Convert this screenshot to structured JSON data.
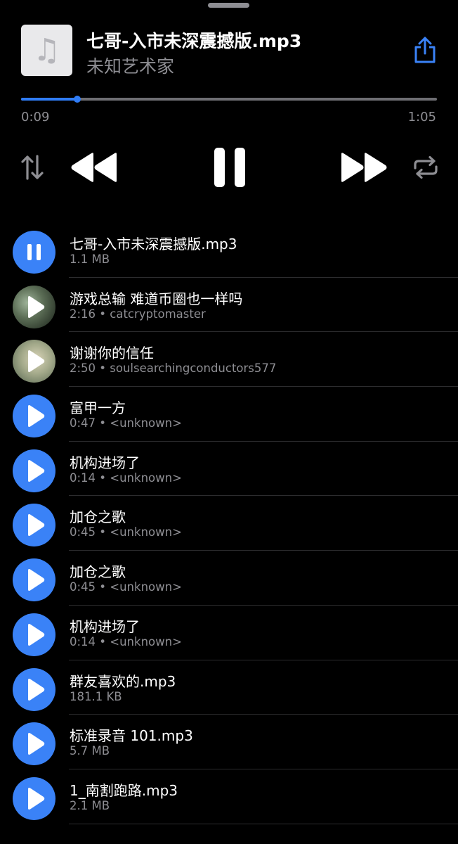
{
  "now_playing": {
    "title": "七哥-入市未深震撼版.mp3",
    "artist": "未知艺术家",
    "elapsed": "0:09",
    "duration": "1:05",
    "progress_fraction": 0.135
  },
  "colors": {
    "accent": "#3a82f7",
    "background": "#000000",
    "secondary_text": "#8e8e93"
  },
  "controls": [
    "sort-icon",
    "rewind-icon",
    "pause-icon",
    "fast-forward-icon",
    "repeat-icon"
  ],
  "tracks": [
    {
      "title": "七哥-入市未深震撼版.mp3",
      "subtitle": "1.1 MB",
      "state": "playing",
      "icon": "pause-icon"
    },
    {
      "title": "游戏总输 难道币圈也一样吗",
      "subtitle": "2:16 • catcryptomaster",
      "state": "thumbnail",
      "icon": "play-icon"
    },
    {
      "title": "谢谢你的信任",
      "subtitle": "2:50 • soulsearchingconductors577",
      "state": "thumbnail",
      "icon": "play-icon"
    },
    {
      "title": "富甲一方",
      "subtitle": "0:47 • <unknown>",
      "state": "idle",
      "icon": "play-icon"
    },
    {
      "title": "机构进场了",
      "subtitle": "0:14 • <unknown>",
      "state": "idle",
      "icon": "play-icon"
    },
    {
      "title": "加仓之歌",
      "subtitle": "0:45 • <unknown>",
      "state": "idle",
      "icon": "play-icon"
    },
    {
      "title": "加仓之歌",
      "subtitle": "0:45 • <unknown>",
      "state": "idle",
      "icon": "play-icon"
    },
    {
      "title": "机构进场了",
      "subtitle": "0:14 • <unknown>",
      "state": "idle",
      "icon": "play-icon"
    },
    {
      "title": "群友喜欢的.mp3",
      "subtitle": "181.1 KB",
      "state": "idle",
      "icon": "play-icon"
    },
    {
      "title": "标准录音 101.mp3",
      "subtitle": "5.7 MB",
      "state": "idle",
      "icon": "play-icon"
    },
    {
      "title": "1_南割跑路.mp3",
      "subtitle": "2.1 MB",
      "state": "idle",
      "icon": "play-icon"
    }
  ]
}
